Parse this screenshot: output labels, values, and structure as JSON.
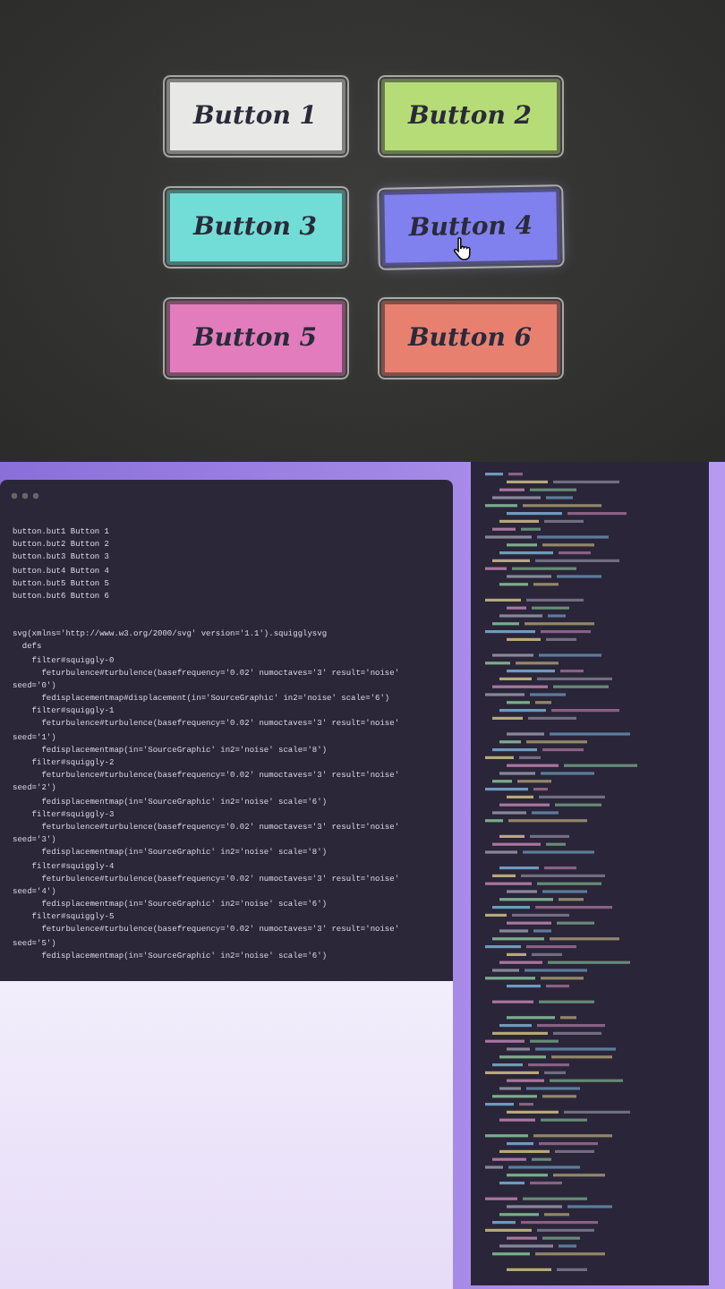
{
  "buttons": [
    {
      "label": "Button 1",
      "color": "#e8e8e6",
      "hovered": false
    },
    {
      "label": "Button 2",
      "color": "#b6dc78",
      "hovered": false
    },
    {
      "label": "Button 3",
      "color": "#72ddd6",
      "hovered": false
    },
    {
      "label": "Button 4",
      "color": "#8080ee",
      "hovered": true
    },
    {
      "label": "Button 5",
      "color": "#e27cbc",
      "hovered": false
    },
    {
      "label": "Button 6",
      "color": "#e88070",
      "hovered": false
    }
  ],
  "editor": {
    "lines": [
      "button.but1 Button 1",
      "button.but2 Button 2",
      "button.but3 Button 3",
      "button.but4 Button 4",
      "button.but5 Button 5",
      "button.but6 Button 6"
    ],
    "svg_lines": [
      "svg(xmlns='http://www.w3.org/2000/svg' version='1.1').squigglysvg",
      "  defs",
      "    filter#squiggly-0",
      "      feturbulence#turbulence(basefrequency='0.02' numoctaves='3' result='noise'",
      "seed='0')",
      "      fedisplacementmap#displacement(in='SourceGraphic' in2='noise' scale='6')",
      "    filter#squiggly-1",
      "      feturbulence#turbulence(basefrequency='0.02' numoctaves='3' result='noise'",
      "seed='1')",
      "      fedisplacementmap(in='SourceGraphic' in2='noise' scale='8')",
      "    filter#squiggly-2",
      "      feturbulence#turbulence(basefrequency='0.02' numoctaves='3' result='noise'",
      "seed='2')",
      "      fedisplacementmap(in='SourceGraphic' in2='noise' scale='6')",
      "    filter#squiggly-3",
      "      feturbulence#turbulence(basefrequency='0.02' numoctaves='3' result='noise'",
      "seed='3')",
      "      fedisplacementmap(in='SourceGraphic' in2='noise' scale='8')",
      "    filter#squiggly-4",
      "      feturbulence#turbulence(basefrequency='0.02' numoctaves='3' result='noise'",
      "seed='4')",
      "      fedisplacementmap(in='SourceGraphic' in2='noise' scale='6')",
      "    filter#squiggly-5",
      "      feturbulence#turbulence(basefrequency='0.02' numoctaves='3' result='noise'",
      "seed='5')",
      "      fedisplacementmap(in='SourceGraphic' in2='noise' scale='6')"
    ]
  }
}
